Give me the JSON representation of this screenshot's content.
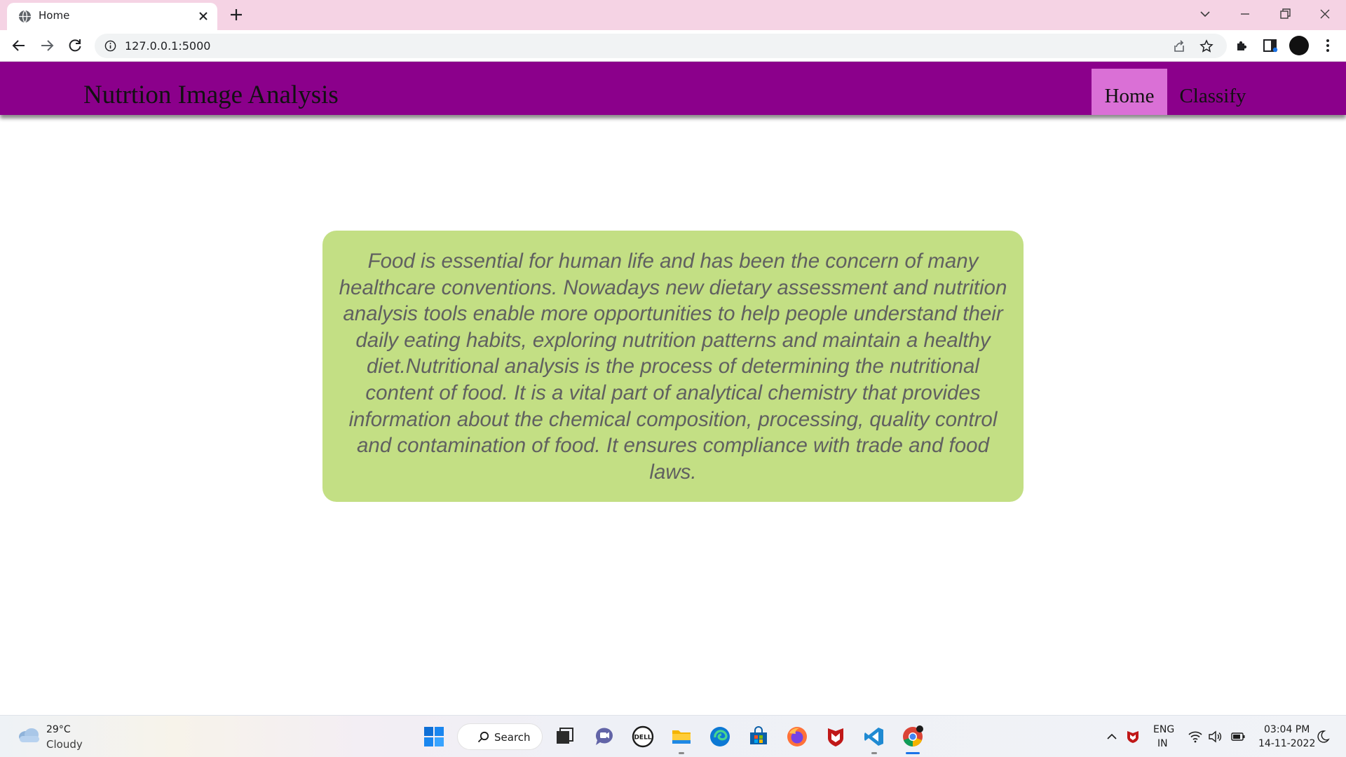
{
  "browser": {
    "tab": {
      "title": "Home"
    },
    "address": {
      "url": "127.0.0.1:5000"
    }
  },
  "site": {
    "brand": "Nutrtion Image Analysis",
    "nav": [
      {
        "label": "Home",
        "active": true
      },
      {
        "label": "Classify",
        "active": false
      }
    ],
    "card_text": "Food is essential for human life and has been the concern of many healthcare conventions. Nowadays new dietary assessment and nutrition analysis tools enable more opportunities to help people understand their daily eating habits, exploring nutrition patterns and maintain a healthy diet.Nutritional analysis is the process of determining the nutritional content of food. It is a vital part of analytical chemistry that provides information about the chemical composition, processing, quality control and contamination of food. It ensures compliance with trade and food laws.",
    "colors": {
      "navbar": "#8b008b",
      "active_nav": "#da70d6",
      "card": "#c3df84",
      "card_text": "#606060"
    }
  },
  "taskbar": {
    "weather": {
      "temp": "29°C",
      "condition": "Cloudy"
    },
    "search_label": "Search",
    "language": {
      "top": "ENG",
      "bottom": "IN"
    },
    "clock": {
      "time": "03:04 PM",
      "date": "14-11-2022"
    }
  }
}
